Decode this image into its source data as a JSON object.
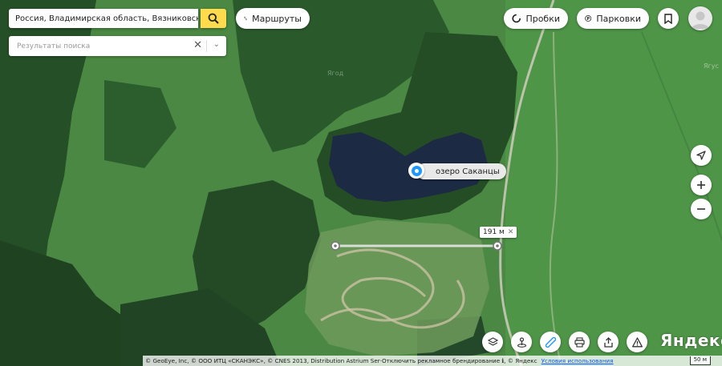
{
  "search": {
    "value": "Россия, Владимирская область, Вязниковский р",
    "results_placeholder": "Результаты поиска"
  },
  "top_controls": {
    "routes_label": "Маршруты",
    "traffic_label": "Пробки",
    "parking_label": "Парковки"
  },
  "icons": {
    "search": "search-icon",
    "routes": "routes-icon",
    "traffic": "traffic-icon",
    "parking": "parking-icon",
    "bookmark": "bookmark-icon",
    "avatar": "avatar-icon",
    "navigation": "navigation-arrow-icon",
    "zoom_in": "plus-icon",
    "zoom_out": "minus-icon",
    "layers": "layers-icon",
    "panorama": "panorama-icon",
    "ruler": "ruler-icon",
    "print": "print-icon",
    "share": "share-icon",
    "report": "warning-icon",
    "clear": "close-icon",
    "dropdown": "chevron-down-icon"
  },
  "map": {
    "place_label": "озеро Саканцы",
    "ruler_distance": "191 м",
    "faint_labels": [
      "Ягус",
      "Ягод"
    ],
    "logo": "Яндекс",
    "copyright": "© GeoEye, Inc, © ООО ИТЦ «СКАНЭКС», © CNES 2013, Distribution Astrium Ser·Отключить рекламное брендирование ℹ, © Яндекс",
    "terms": "Условия использования",
    "scale": "50 м"
  },
  "colors": {
    "accent_yellow": "#ffdb4d",
    "marker_blue": "#1e98ff",
    "lake": "#1c2a44",
    "field": "#4d8f46",
    "forest": "#234d25"
  }
}
